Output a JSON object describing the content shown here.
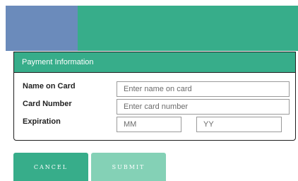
{
  "colors": {
    "banner_green": "#37ad8a",
    "banner_blue": "#6b8bbb",
    "submit_disabled": "#84d1b6"
  },
  "panel": {
    "title": "Payment Information"
  },
  "form": {
    "name_label": "Name on Card",
    "name_placeholder": "Enter name on card",
    "name_value": "",
    "card_label": "Card Number",
    "card_placeholder": "Enter card number",
    "card_value": "",
    "expiration_label": "Expiration",
    "month_placeholder": "MM",
    "month_value": "",
    "year_placeholder": "YY",
    "year_value": ""
  },
  "buttons": {
    "cancel_label": "CANCEL",
    "submit_label": "SUBMIT"
  }
}
